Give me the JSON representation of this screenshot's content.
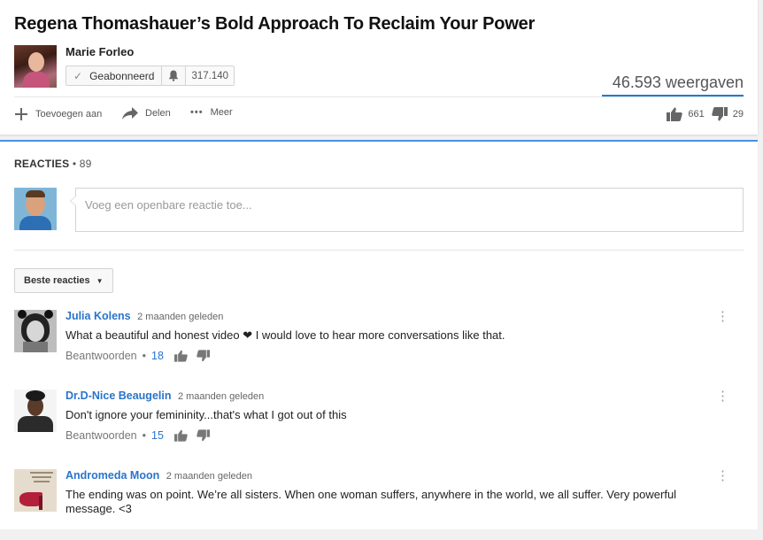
{
  "video": {
    "title": "Regena Thomashauer’s Bold Approach To Reclaim Your Power",
    "channel_name": "Marie Forleo",
    "subscribe_label": "Geabonneerd",
    "subscriber_count": "317.140",
    "views": "46.593 weergaven"
  },
  "actions": {
    "add_label": "Toevoegen aan",
    "share_label": "Delen",
    "more_label": "Meer",
    "likes": "661",
    "dislikes": "29"
  },
  "comments": {
    "header": "REACTIES",
    "count": "• 89",
    "placeholder": "Voeg een openbare reactie toe...",
    "sort_label": "Beste reacties",
    "reply_label": "Beantwoorden",
    "items": [
      {
        "author": "Julia Kolens",
        "time": "2 maanden geleden",
        "text": "What a beautiful and honest video ❤ I would love to hear more conversations like that.",
        "likes": "18"
      },
      {
        "author": "Dr.D-Nice Beaugelin",
        "time": "2 maanden geleden",
        "text": "Don't ignore your femininity...that's what I got out of this",
        "likes": "15"
      },
      {
        "author": "Andromeda Moon",
        "time": "2 maanden geleden",
        "text": "The ending was on point.  We’re all sisters.  When one woman suffers, anywhere in the world, we all suffer. Very powerful message. <3",
        "likes": ""
      }
    ]
  },
  "colors": {
    "link_blue": "#2a74c9",
    "accent_blue": "#1e7cd4",
    "text": "#222222"
  }
}
